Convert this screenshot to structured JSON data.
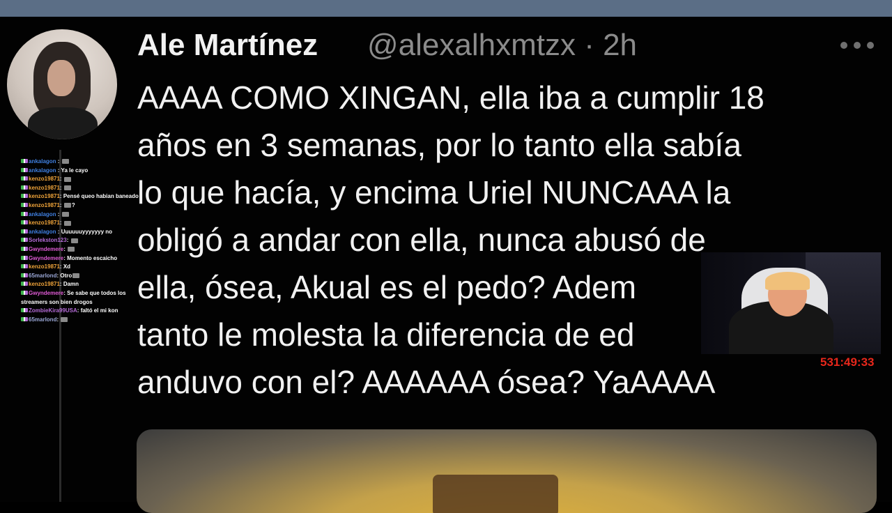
{
  "tweet": {
    "user_name": "Ale Martínez",
    "handle_time": "@alexalhxmtzx · 2h",
    "lines": [
      "AAAA COMO XINGAN, ella iba a cumplir 18",
      "años en 3 semanas, por lo tanto ella sabía",
      "lo que hacía, y encima Uriel NUNCAAA la",
      "obligó a andar con ella, nunca abusó de",
      "ella, ósea, Akual es el pedo? Adem",
      "tanto le molesta la diferencia de ed",
      "anduvo con el? AAAAAA ósea? YaAAAA"
    ],
    "more_icon": "more-horizontal-icon"
  },
  "chat": {
    "messages": [
      {
        "user": "ankalagon",
        "sep": " : ",
        "text": "",
        "color": "#3f7fe0"
      },
      {
        "user": "ankalagon",
        "sep": " : ",
        "text": "Ya le cayo",
        "color": "#3f7fe0"
      },
      {
        "user": "kenzo19871",
        "sep": ": ",
        "text": "",
        "color": "#f0a43a"
      },
      {
        "user": "kenzo19871",
        "sep": ": ",
        "text": "",
        "color": "#f0a43a"
      },
      {
        "user": "kenzo19871",
        "sep": ": ",
        "text": "Pensé queo habian baneado",
        "color": "#f0a43a"
      },
      {
        "user": "kenzo19871",
        "sep": ": ",
        "text": "?",
        "color": "#f0a43a"
      },
      {
        "user": "ankalagon",
        "sep": " : ",
        "text": "",
        "color": "#3f7fe0"
      },
      {
        "user": "kenzo19871",
        "sep": ": ",
        "text": "",
        "color": "#f0a43a"
      },
      {
        "user": "ankalagon",
        "sep": " : ",
        "text": "Uuuuuuyyyyyyy no",
        "color": "#3f7fe0"
      },
      {
        "user": "Sorlekston123",
        "sep": ": ",
        "text": "",
        "color": "#b46bd6"
      },
      {
        "user": "Gwyndemere",
        "sep": ": ",
        "text": "",
        "color": "#e05bd6"
      },
      {
        "user": "Gwyndemere",
        "sep": ": ",
        "text": "Momento escaicho",
        "color": "#e05bd6"
      },
      {
        "user": "kenzo19871",
        "sep": ": ",
        "text": "Xd",
        "color": "#f0a43a"
      },
      {
        "user": "65marlond",
        "sep": ": ",
        "text": "Otro",
        "color": "#9aa7d6"
      },
      {
        "user": "kenzo19871",
        "sep": ": ",
        "text": "Damn",
        "color": "#f0a43a"
      },
      {
        "user": "Gwyndemere",
        "sep": ": ",
        "text": "Se sabe que todos los streamers son bien drogos",
        "color": "#e05bd6"
      },
      {
        "user": "ZombieKira99USA",
        "sep": ": ",
        "text": "faltó el  mi kon",
        "color": "#b46bd6"
      },
      {
        "user": "65marlond",
        "sep": ": ",
        "text": "",
        "color": "#9aa7d6"
      }
    ]
  },
  "stream": {
    "timer": "531:49:33"
  }
}
